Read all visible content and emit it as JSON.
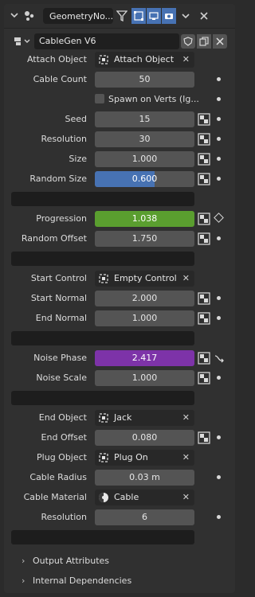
{
  "header": {
    "tab_label": "GeometryNo...",
    "icons": [
      "chevron-down-icon",
      "modifier-wrench-icon",
      "filter-icon",
      "edit-mode-icon",
      "viewport-icon",
      "render-camera-icon",
      "dropdown-chevron-icon",
      "close-icon"
    ]
  },
  "node_group": {
    "name": "CableGen V6",
    "icons": [
      "node-tree-icon",
      "shield-fake-user-icon",
      "duplicate-icon",
      "unlink-icon"
    ]
  },
  "rows": {
    "attach_object": {
      "label": "Attach Object",
      "value": "Attach Object"
    },
    "cable_count": {
      "label": "Cable Count",
      "value": "50"
    },
    "spawn_on_verts": {
      "label": "Spawn on Verts (Ig...",
      "checked": false
    },
    "seed": {
      "label": "Seed",
      "value": "15"
    },
    "resolution": {
      "label": "Resolution",
      "value": "30"
    },
    "size": {
      "label": "Size",
      "value": "1.000"
    },
    "random_size": {
      "label": "Random Size",
      "value": "0.600",
      "fill_fraction": 0.6
    },
    "progression": {
      "label": "Progression",
      "value": "1.038"
    },
    "random_offset": {
      "label": "Random Offset",
      "value": "1.750"
    },
    "start_control": {
      "label": "Start Control",
      "value": "Empty Control"
    },
    "start_normal": {
      "label": "Start Normal",
      "value": "2.000"
    },
    "end_normal": {
      "label": "End Normal",
      "value": "1.000"
    },
    "noise_phase": {
      "label": "Noise Phase",
      "value": "2.417"
    },
    "noise_scale": {
      "label": "Noise Scale",
      "value": "1.000"
    },
    "end_object": {
      "label": "End Object",
      "value": "Jack"
    },
    "end_offset": {
      "label": "End Offset",
      "value": "0.080"
    },
    "plug_object": {
      "label": "Plug Object",
      "value": "Plug On"
    },
    "cable_radius": {
      "label": "Cable Radius",
      "value": "0.03 m"
    },
    "cable_material": {
      "label": "Cable Material",
      "value": "Cable"
    },
    "resolution2": {
      "label": "Resolution",
      "value": "6"
    }
  },
  "subpanels": {
    "output_attributes": "Output Attributes",
    "internal_dependencies": "Internal Dependencies"
  },
  "colors": {
    "accent_blue": "#4772b3",
    "progression_green": "#5a9e2f",
    "noise_phase_purple": "#7d33a8"
  }
}
